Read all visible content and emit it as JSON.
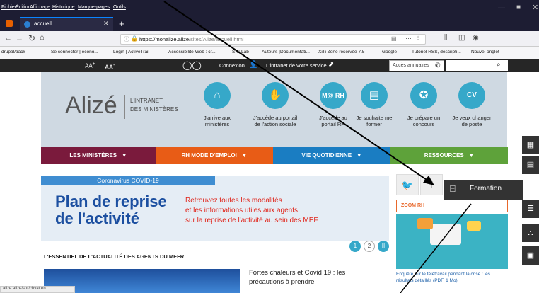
{
  "browser": {
    "menu": [
      "Fichier",
      "Édition",
      "Affichage",
      "Historique",
      "Marque-pages",
      "Outils"
    ],
    "tab_title": "accueil",
    "url": "https://monalize.alize/sites/Alize/accueil.html",
    "url_host": "https://monalize.alize",
    "url_path": "/sites/Alize/accueil.html",
    "bookmarks": [
      "drupal/back",
      "Se connecter | econo...",
      "Login | ActiveTrail",
      "Accessibilité Web : cr...",
      "SIG Lab",
      "Auteurs [Documentati...",
      "XiTi Zone réservée 7.5",
      "Google",
      "Tutoriel RSS, descripti...",
      "Nouvel onglet"
    ],
    "status_url": "alize.alize/sur/chvat.en"
  },
  "topbar": {
    "font_small": "AA",
    "font_big": "AA",
    "connexion": "Connexion",
    "intranet_label": "L'intranet de votre service",
    "search_placeholder": "Accès annuaires"
  },
  "header": {
    "logo": "Alizé",
    "subtitle_line1": "L'INTRANET",
    "subtitle_line2": "DES MINISTÈRES",
    "quicklinks": [
      {
        "icon": "home-icon",
        "glyph": "⌂",
        "line1": "J'arrive aux",
        "line2": "ministères"
      },
      {
        "icon": "handshake-icon",
        "glyph": "✋",
        "line1": "J'accède au portail",
        "line2": "de l'action sociale"
      },
      {
        "icon": "mrh-icon",
        "glyph": "M@ RH",
        "line1": "J'accède au",
        "line2": "portail RH"
      },
      {
        "icon": "book-icon",
        "glyph": "▤",
        "line1": "Je souhaite me",
        "line2": "former"
      },
      {
        "icon": "medal-icon",
        "glyph": "✪",
        "line1": "Je prépare un",
        "line2": "concours"
      },
      {
        "icon": "cv-icon",
        "glyph": "CV",
        "line1": "Je veux changer",
        "line2": "de poste"
      }
    ]
  },
  "nav": [
    {
      "label": "LES MINISTÈRES",
      "color": "#7a1a3c"
    },
    {
      "label": "RH MODE D'EMPLOI",
      "color": "#e85c16"
    },
    {
      "label": "VIE QUOTIDIENNE",
      "color": "#1a7dc2"
    },
    {
      "label": "RESSOURCES",
      "color": "#5ea23a"
    }
  ],
  "banner": {
    "tag": "Coronavirus COVID-19",
    "title_line1": "Plan de reprise",
    "title_line2": "de l'activité",
    "text_line1": "Retrouvez toutes les modalités",
    "text_line2": "et les informations utiles aux agents",
    "text_line3": "sur la reprise de l'activité au sein des MEF"
  },
  "pager": [
    "1",
    "2",
    "II"
  ],
  "section_title": "L'ESSENTIEL DE L'ACTUALITÉ DES AGENTS DU MEFR",
  "article": {
    "title_line1": "Fortes chaleurs et Covid 19 : les",
    "title_line2": "précautions à prendre"
  },
  "right": {
    "zoom_title": "ZOOM RH",
    "zoom_caption_line1": "Enquête sur le télétravail pendant la crise : les",
    "zoom_caption_line2": "résultats détaillés (PDF, 1 Mo)"
  },
  "sidebar": {
    "formation": "Formation"
  }
}
